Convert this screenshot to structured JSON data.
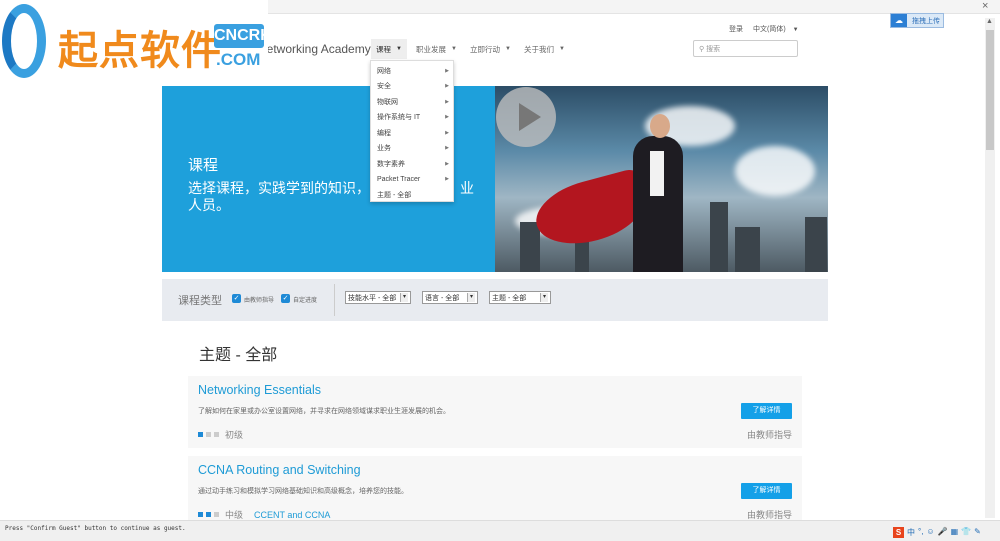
{
  "watermark": {
    "text": "起点软件",
    "badge_top": "CNCRK",
    "badge_bottom": ".COM"
  },
  "browser": {
    "close": "×",
    "upload_label": "拖拽上传"
  },
  "header": {
    "brand": "Networking Academy",
    "login": "登录",
    "language": "中文(简体)"
  },
  "nav": [
    {
      "label": "课程"
    },
    {
      "label": "职业发展"
    },
    {
      "label": "立即行动"
    },
    {
      "label": "关于我们"
    }
  ],
  "search": {
    "placeholder": "搜索"
  },
  "menu": [
    {
      "label": "网络",
      "sub": true
    },
    {
      "label": "安全",
      "sub": true
    },
    {
      "label": "物联网",
      "sub": true
    },
    {
      "label": "操作系统与 IT",
      "sub": true
    },
    {
      "label": "编程",
      "sub": true
    },
    {
      "label": "业务",
      "sub": true
    },
    {
      "label": "数字素养",
      "sub": true
    },
    {
      "label": "Packet Tracer",
      "sub": true
    },
    {
      "label": "主题 - 全部",
      "sub": false
    }
  ],
  "hero": {
    "title": "课程",
    "desc_line1": "选择课程，实践学到的知识，",
    "desc_tail": "业",
    "desc_line2": "人员。"
  },
  "filter": {
    "title": "课程类型",
    "checkboxes": [
      {
        "label": "由教师指导",
        "checked": true
      },
      {
        "label": "自定进度",
        "checked": true
      }
    ],
    "selects": [
      {
        "value": "技能水平 - 全部"
      },
      {
        "value": "语言 - 全部"
      },
      {
        "value": "主题 - 全部"
      }
    ]
  },
  "catalog": {
    "title": "主题 - 全部",
    "courses": [
      {
        "name": "Networking Essentials",
        "desc": "了解如何在家里或办公室设置网络，并寻求在网络领域谋求职业生涯发展的机会。",
        "button": "了解详情",
        "level": "初级",
        "level_value": 1,
        "level_max": 3,
        "cert": "",
        "mode": "由教师指导"
      },
      {
        "name": "CCNA Routing and Switching",
        "desc": "通过动手练习和模拟学习网络基础知识和高级概念，培养您的技能。",
        "button": "了解详情",
        "level": "中级",
        "level_value": 2,
        "level_max": 3,
        "cert": "CCENT and CCNA",
        "mode": "由教师指导"
      }
    ]
  },
  "statusbar": {
    "text": "Press \"Confirm Guest\" button to continue as guest.",
    "ime": "中"
  },
  "colors": {
    "accent": "#1ea0db",
    "button": "#14a0e8",
    "filter_bg": "#e8ebf0"
  }
}
